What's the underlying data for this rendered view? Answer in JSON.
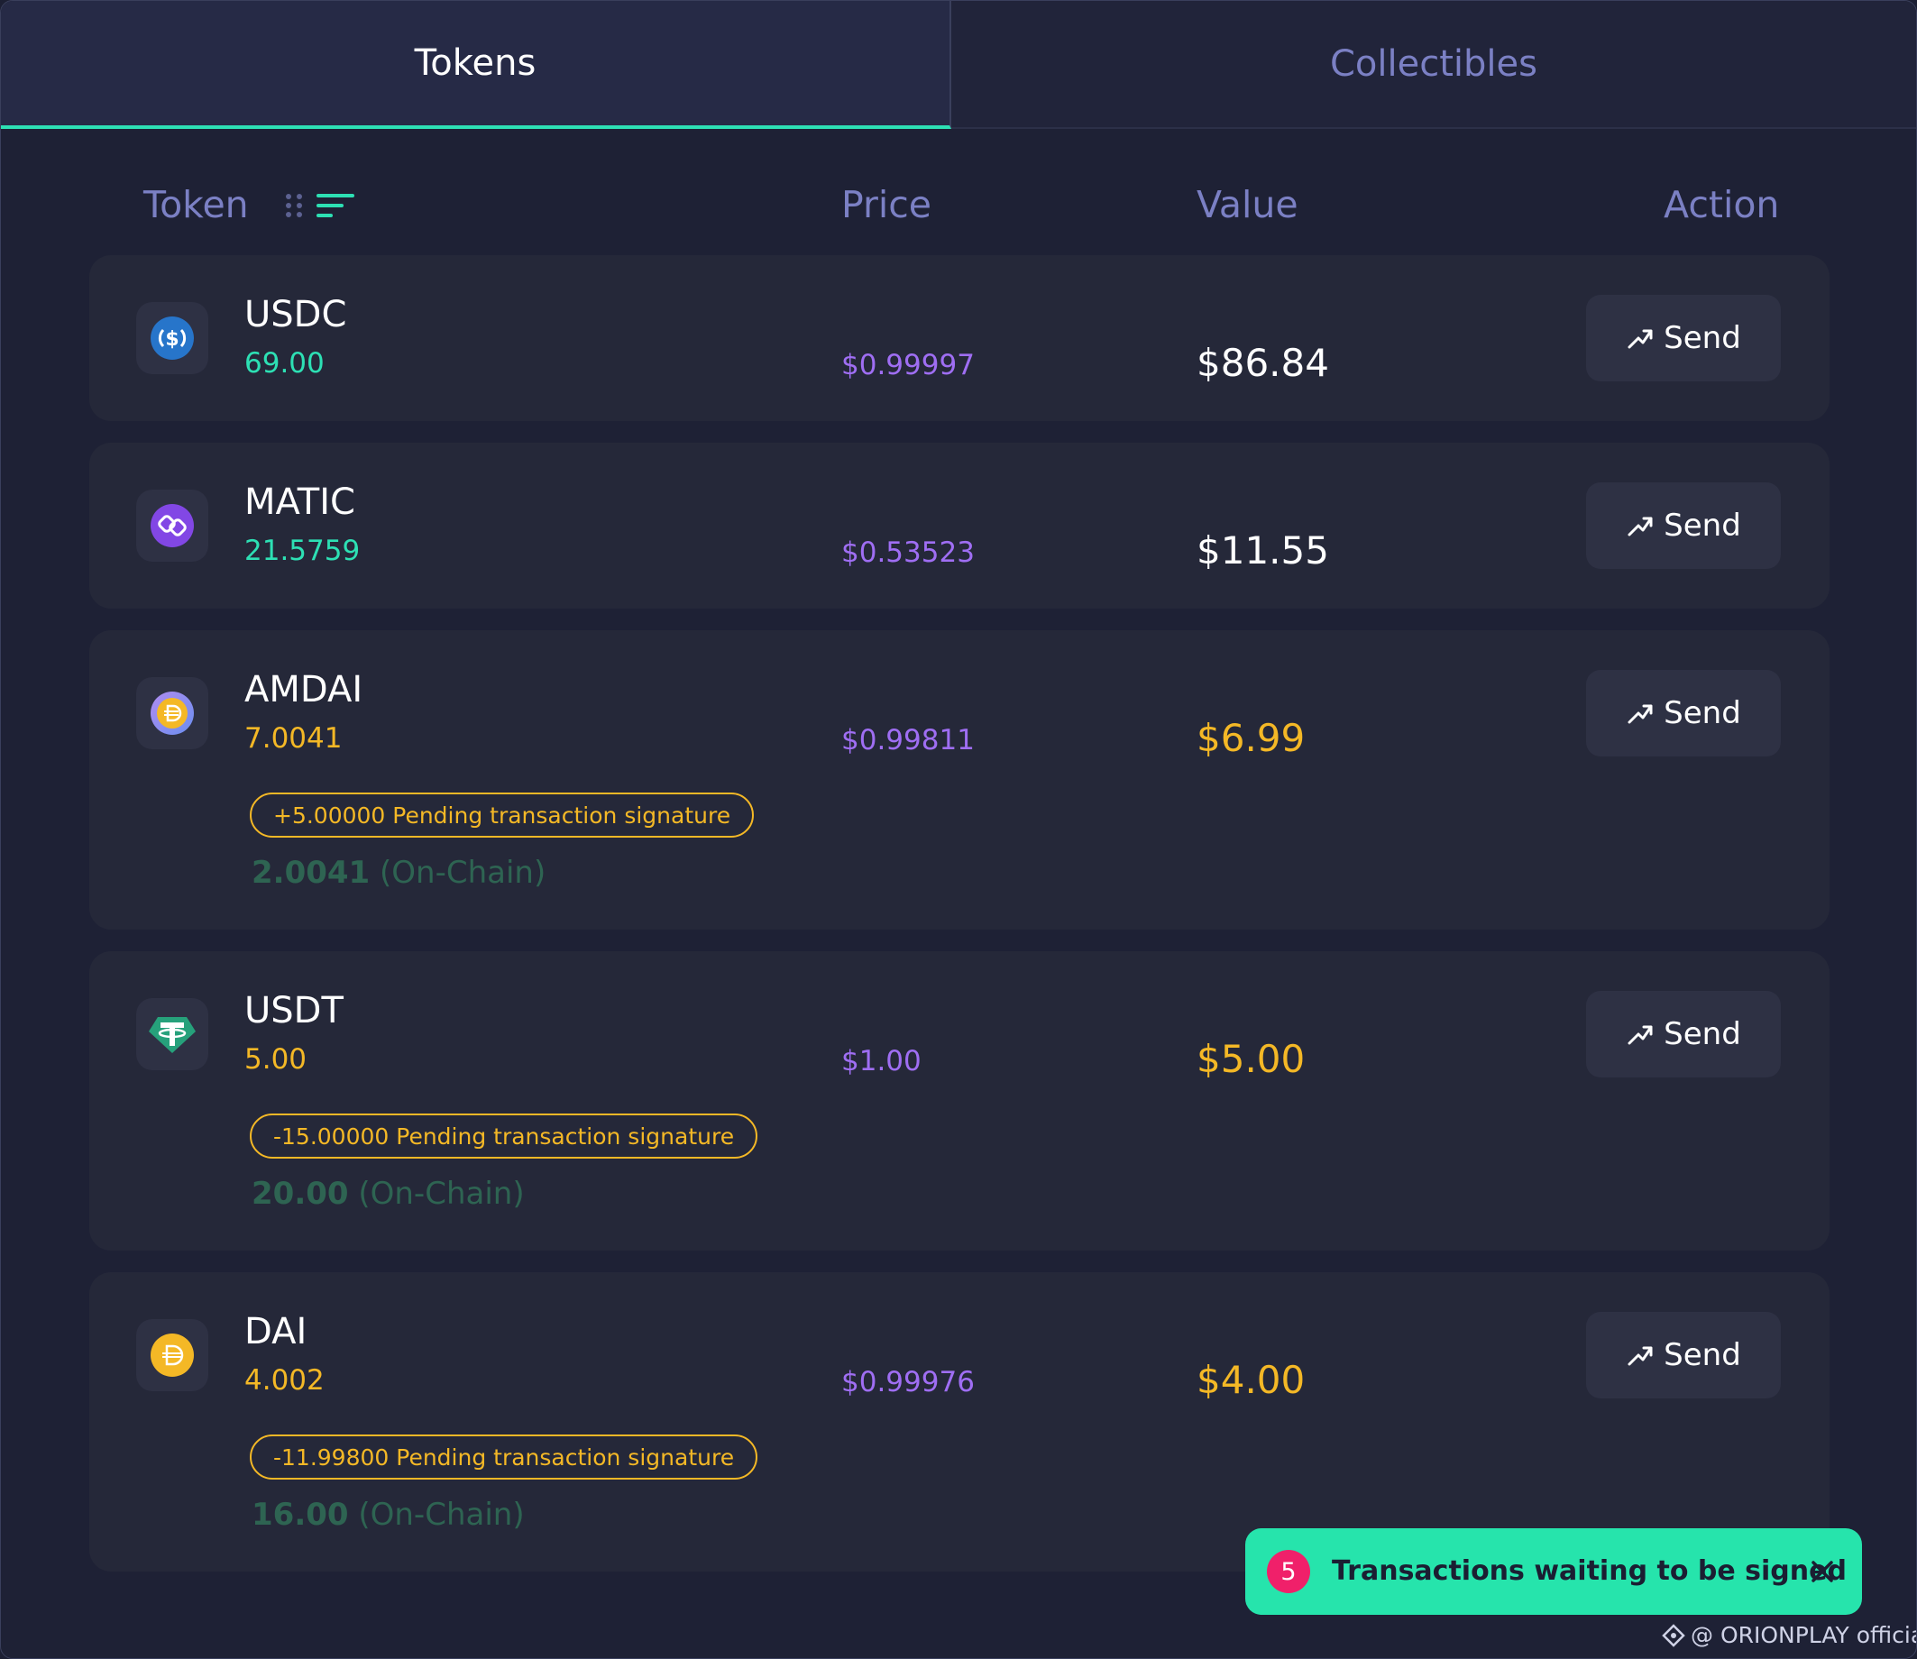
{
  "tabs": [
    {
      "label": "Tokens",
      "active": true
    },
    {
      "label": "Collectibles",
      "active": false
    }
  ],
  "table": {
    "headers": {
      "token": "Token",
      "price": "Price",
      "value": "Value",
      "action": "Action"
    }
  },
  "tokens": [
    {
      "symbol": "USDC",
      "balance": "69.00",
      "price": "$0.99997",
      "value": "$86.84",
      "send_label": "Send",
      "icon": "usdc-icon"
    },
    {
      "symbol": "MATIC",
      "balance": "21.5759",
      "price": "$0.53523",
      "value": "$11.55",
      "send_label": "Send",
      "icon": "matic-icon"
    },
    {
      "symbol": "AMDAI",
      "balance": "7.0041",
      "price": "$0.99811",
      "value": "$6.99",
      "send_label": "Send",
      "icon": "amdai-icon",
      "pending": "+5.00000 Pending transaction signature",
      "onchain_amount": "2.0041",
      "onchain_label": "(On-Chain)"
    },
    {
      "symbol": "USDT",
      "balance": "5.00",
      "price": "$1.00",
      "value": "$5.00",
      "send_label": "Send",
      "icon": "usdt-icon",
      "pending": "-15.00000 Pending transaction signature",
      "onchain_amount": "20.00",
      "onchain_label": "(On-Chain)"
    },
    {
      "symbol": "DAI",
      "balance": "4.002",
      "price": "$0.99976",
      "value": "$4.00",
      "send_label": "Send",
      "icon": "dai-icon",
      "pending": "-11.99800 Pending transaction signature",
      "onchain_amount": "16.00",
      "onchain_label": "(On-Chain)"
    }
  ],
  "toast": {
    "count": "5",
    "message": "Transactions waiting to be signed"
  },
  "watermark": "@ ORIONPLAY official",
  "colors": {
    "accent_green": "#2de0b4",
    "pending_gold": "#f4b826",
    "price_purple": "#9f6ef3",
    "toast_bg": "#26e4ac",
    "badge_pink": "#f0206a"
  }
}
